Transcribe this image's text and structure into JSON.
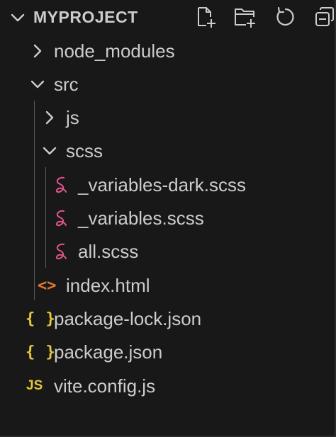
{
  "explorer": {
    "section_title": "MYPROJECT",
    "actions": [
      {
        "name": "new-file-icon"
      },
      {
        "name": "new-folder-icon"
      },
      {
        "name": "refresh-icon"
      },
      {
        "name": "collapse-all-icon"
      }
    ]
  },
  "tree": {
    "node_modules": "node_modules",
    "src": "src",
    "js": "js",
    "scss": "scss",
    "variables_dark": "_variables-dark.scss",
    "variables": "_variables.scss",
    "all": "all.scss",
    "index_html": "index.html",
    "package_lock": "package-lock.json",
    "package": "package.json",
    "vite_config": "vite.config.js"
  },
  "icons": {
    "json_glyph": "{ }",
    "js_glyph": "JS",
    "html_glyph": "<>"
  },
  "colors": {
    "background": "#181818",
    "text": "#cccccc",
    "sass_icon": "#e0558b",
    "json_icon": "#e2c63b",
    "html_icon": "#e37933"
  }
}
